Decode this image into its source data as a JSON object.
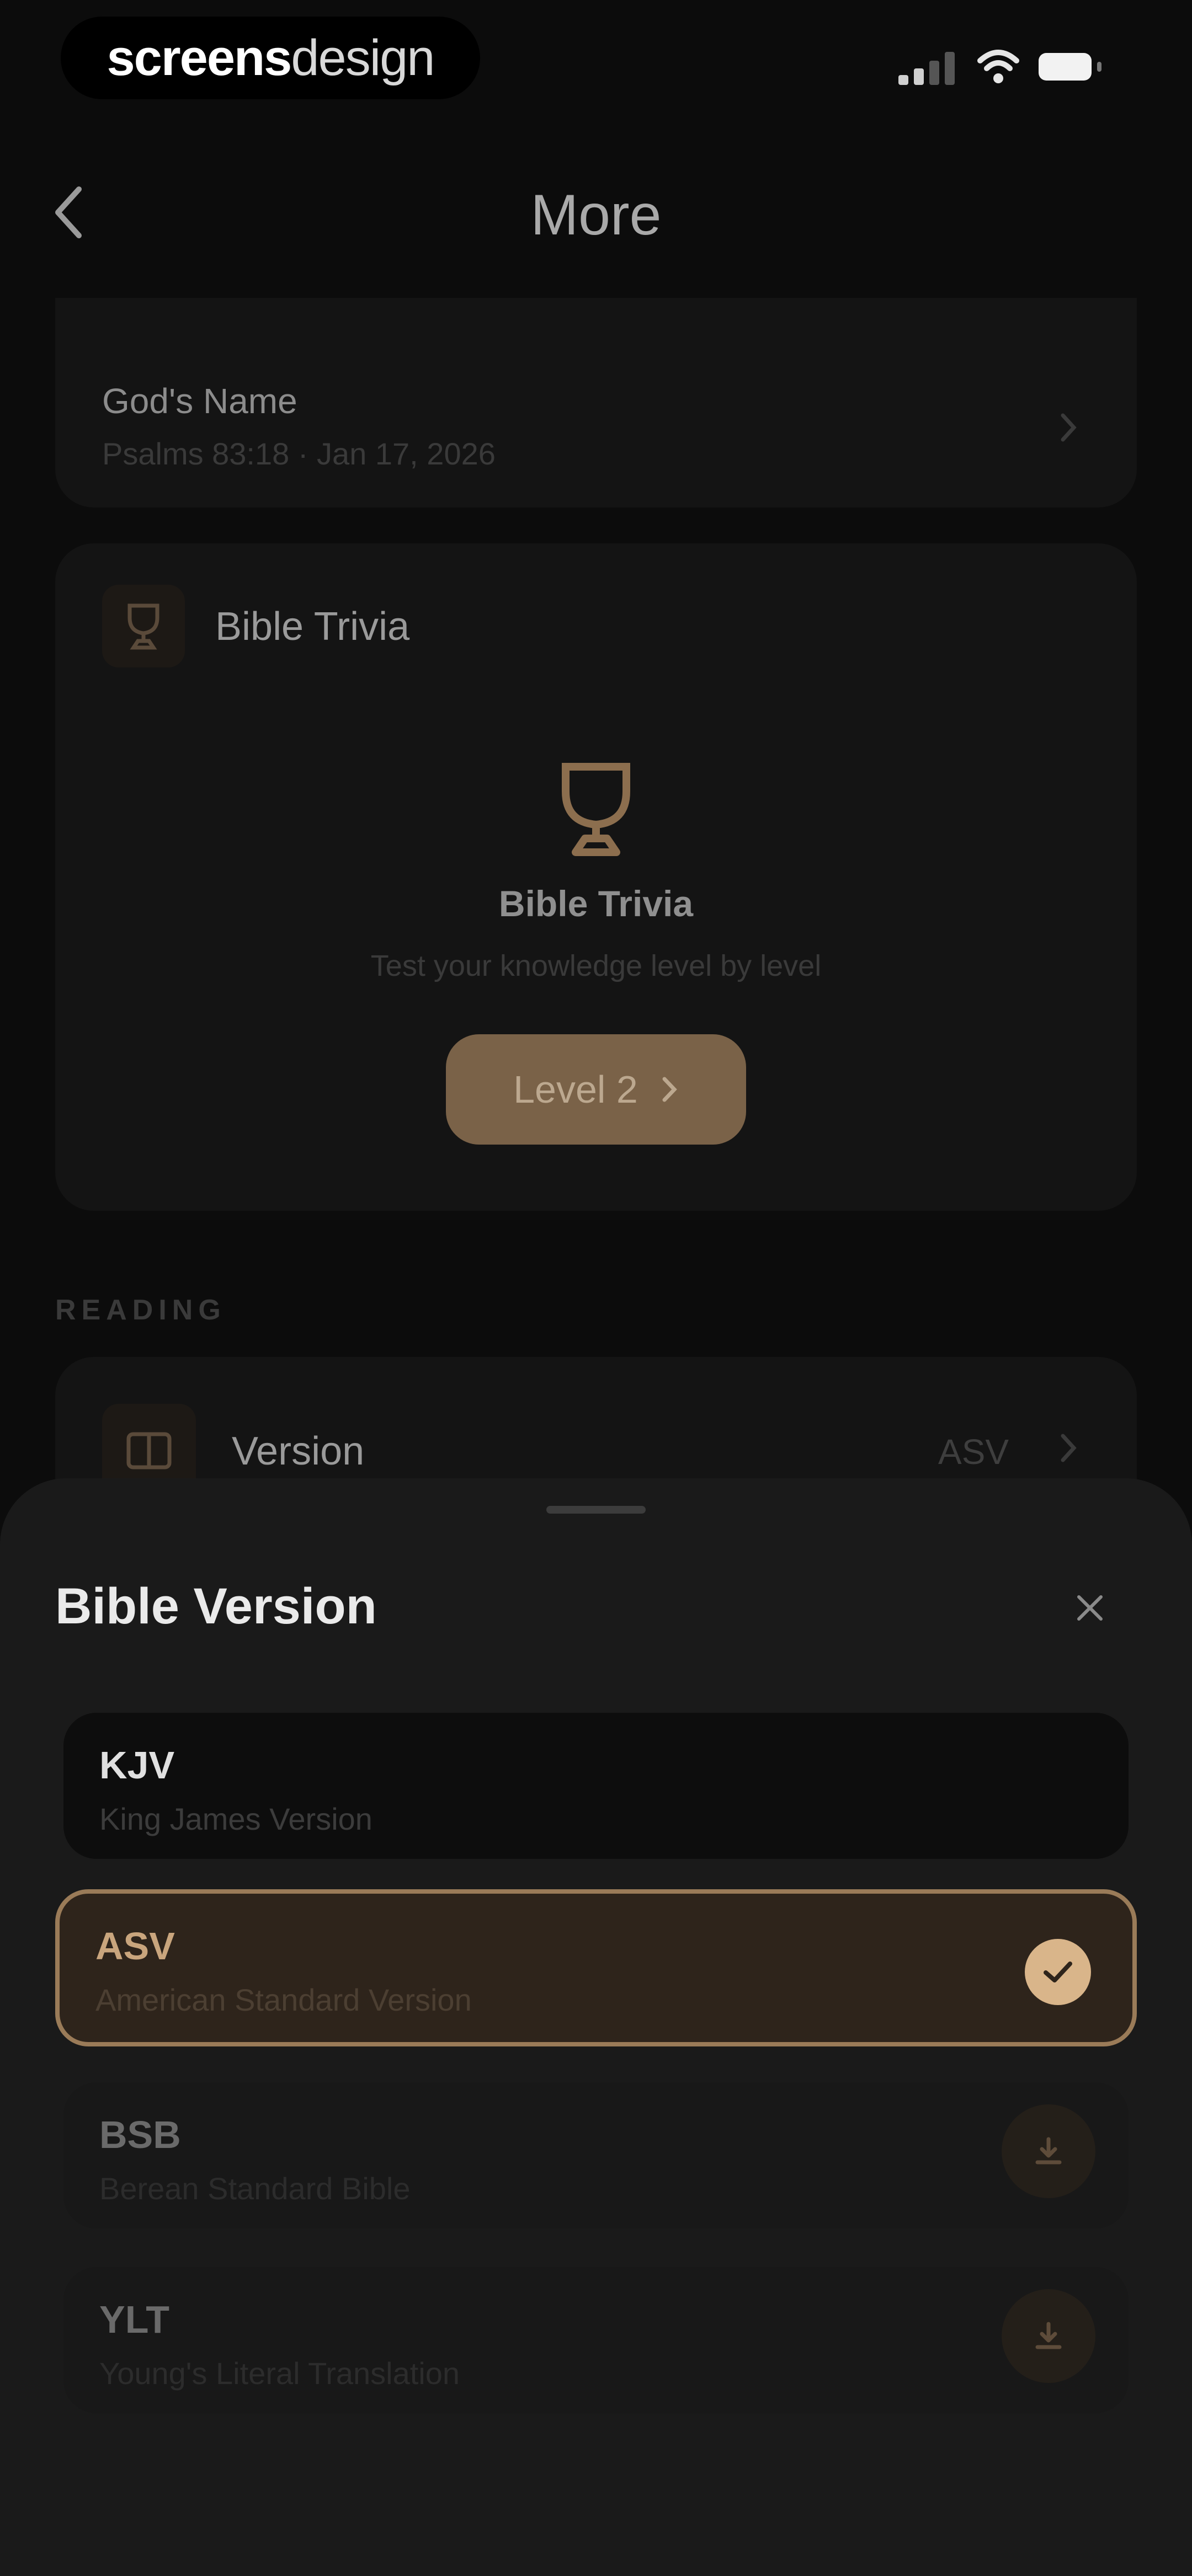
{
  "status_bar": {
    "brand_part1": "screens",
    "brand_part2": "design"
  },
  "header": {
    "title": "More"
  },
  "background": {
    "gods_name": {
      "title": "God's Name",
      "subtitle": "Psalms 83:18 · Jan 17, 2026"
    },
    "trivia": {
      "header_label": "Bible Trivia",
      "title": "Bible Trivia",
      "subtitle": "Test your knowledge level by level",
      "button_label": "Level 2"
    },
    "reading_section_label": "READING",
    "version_row": {
      "label": "Version",
      "value": "ASV"
    }
  },
  "sheet": {
    "title": "Bible Version",
    "options": [
      {
        "code": "KJV",
        "name": "King James Version",
        "state": "available"
      },
      {
        "code": "ASV",
        "name": "American Standard Version",
        "state": "selected"
      },
      {
        "code": "BSB",
        "name": "Berean Standard Bible",
        "state": "download"
      },
      {
        "code": "YLT",
        "name": "Young's Literal Translation",
        "state": "download"
      }
    ]
  },
  "colors": {
    "accent": "#d9b58a",
    "accent_dark": "#9a7b58",
    "background": "#0c0c0c",
    "sheet": "#1a1a1a"
  },
  "icons": {
    "back": "chevron-left-icon",
    "chevron": "chevron-right-icon",
    "trophy": "trophy-icon",
    "book": "book-icon",
    "close": "close-icon",
    "check": "check-icon",
    "download": "download-icon"
  }
}
